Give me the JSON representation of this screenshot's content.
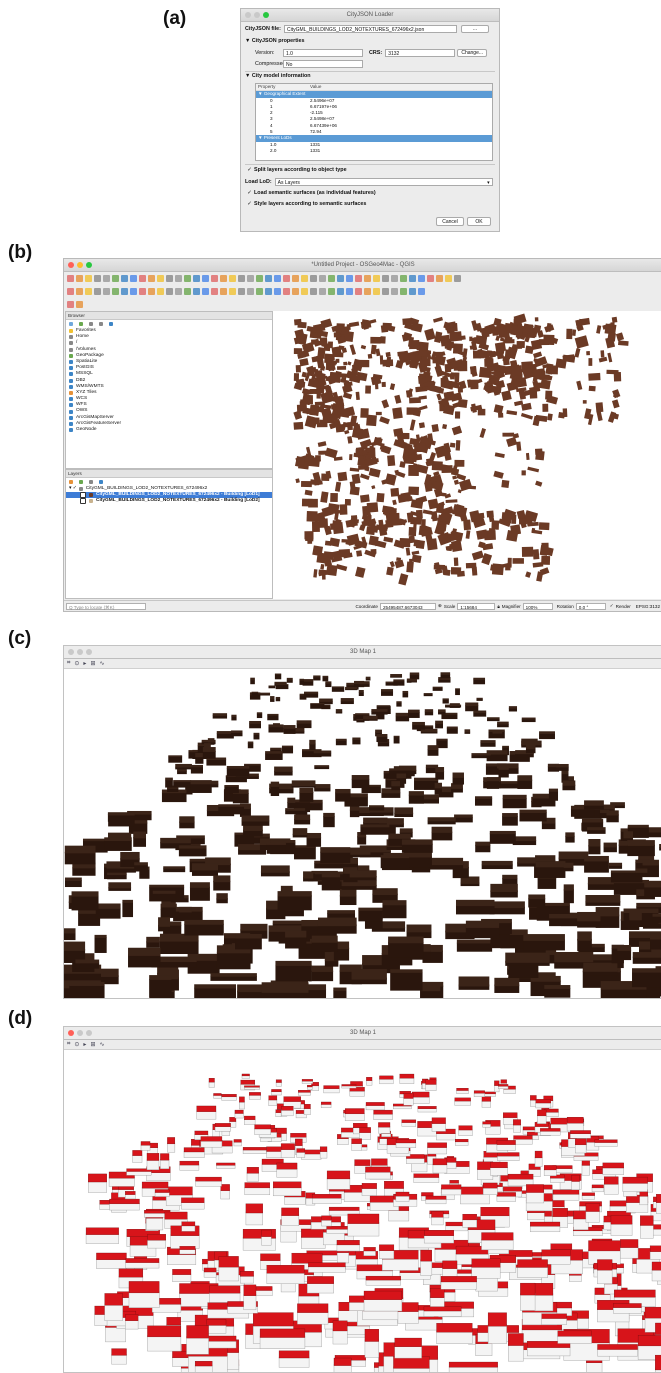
{
  "panel_labels": [
    "(a)",
    "(b)",
    "(c)",
    "(d)"
  ],
  "loader": {
    "window_title": "CityJSON Loader",
    "file_label": "CityJSON file:",
    "file_value": "CityGML_BUILDINGS_LOD2_NOTEXTURES_672496x2.json",
    "browse_label": "...",
    "properties_section": "▼ CityJSON properties",
    "version_label": "Version:",
    "version_value": "1.0",
    "crs_label": "CRS:",
    "crs_value": "3132",
    "change_label": "Change...",
    "compressed_label": "Compressed:",
    "compressed_value": "No",
    "model_section": "▼ City model information",
    "tree_header": [
      "Property",
      "Value"
    ],
    "tree_rows": [
      {
        "property": "▼  Geographical Extent",
        "value": "",
        "highlight": true
      },
      {
        "property": "0",
        "value": "2.5496e+07",
        "highlight": false
      },
      {
        "property": "1",
        "value": "6.67197e+06",
        "highlight": false
      },
      {
        "property": "2",
        "value": "-2.115",
        "highlight": false
      },
      {
        "property": "3",
        "value": "2.5498e+07",
        "highlight": false
      },
      {
        "property": "4",
        "value": "6.67439e+06",
        "highlight": false
      },
      {
        "property": "5",
        "value": "72.94",
        "highlight": false
      },
      {
        "property": "▼  Present LoDs",
        "value": "",
        "highlight": true
      },
      {
        "property": "1.0",
        "value": "1331",
        "highlight": false
      },
      {
        "property": "2.0",
        "value": "1331",
        "highlight": false
      }
    ],
    "split_layers": "Split layers according to object type",
    "load_lod_label": "Load LoD:",
    "load_lod_value": "As Layers",
    "semantic_surfaces": "Load semantic surfaces (as individual features)",
    "style_layers": "Style layers according to semantic surfaces",
    "cancel_label": "Cancel",
    "ok_label": "OK"
  },
  "qgis": {
    "window_title": "*Untitled Project - OSGeo4Mac - QGIS",
    "browser_title": "Browser",
    "browser_items": [
      "Favorites",
      "Home",
      "/",
      "/Volumes",
      "GeoPackage",
      "SpatiaLite",
      "PostGIS",
      "MSSQL",
      "DB2",
      "WMS/WMTS",
      "XYZ Tiles",
      "WCS",
      "WFS",
      "OWS",
      "ArcGisMapServer",
      "ArcGisFeatureServer",
      "GeoNode"
    ],
    "layers_title": "Layers",
    "layer_group": "CityGML_BUILDINGS_LOD2_NOTEXTURES_672496x2",
    "layer_1": "CityGML_BUILDINGS_LOD2_NOTEXTURES_672496x2 - Building [LoD1]",
    "layer_2": "CityGML_BUILDINGS_LOD2_NOTEXTURES_672496x2 - Building [LoD2]",
    "locate_placeholder": "Q  Type to locate (⌘K)",
    "coordinate_label": "Coordinate",
    "coordinate_value": "25495487,6673043",
    "scale_label": "Scale",
    "scale_value": "1:15684",
    "magnifier_label": "Magnifier",
    "magnifier_value": "100%",
    "rotation_label": "Rotation",
    "rotation_value": "0.0 °",
    "render_label": "Render",
    "crs_label": "EPSG:3132"
  },
  "view3d_c": {
    "window_title": "3D Map 1"
  },
  "view3d_d": {
    "window_title": "3D Map 1"
  },
  "colors": {
    "building_2d": "#6b3a25",
    "building_3d_dark": "#3b2418",
    "roof_red": "#d7141a",
    "highlight": "#5b9bd5"
  }
}
